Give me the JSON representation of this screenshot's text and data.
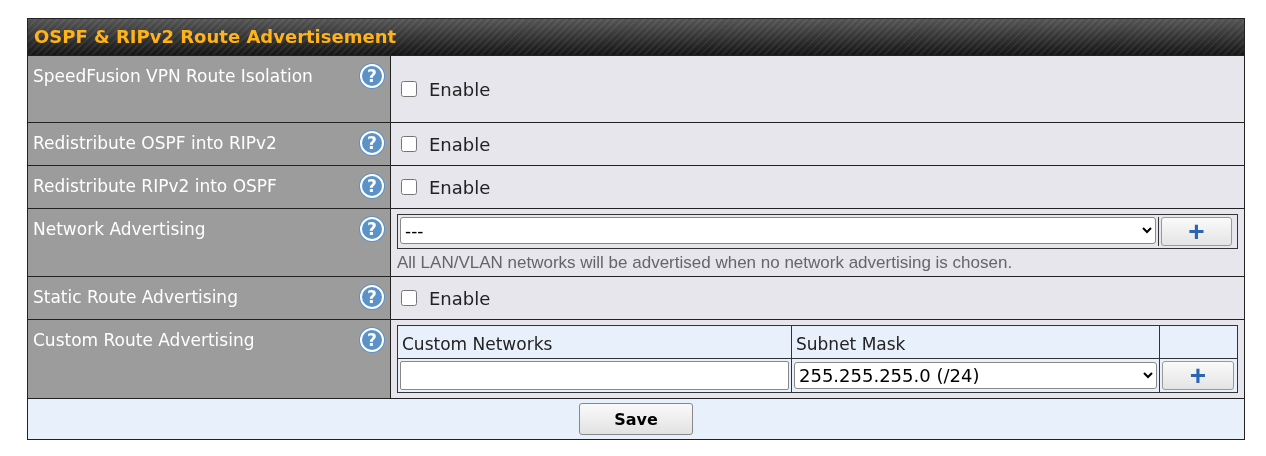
{
  "section": {
    "title": "OSPF & RIPv2 Route Advertisement"
  },
  "rows": [
    {
      "kind": "checkbox",
      "label": "SpeedFusion VPN Route Isolation",
      "help": "?",
      "option": "Enable",
      "checked": false
    },
    {
      "kind": "checkbox",
      "label": "Redistribute OSPF into RIPv2",
      "help": "?",
      "option": "Enable",
      "checked": false
    },
    {
      "kind": "checkbox",
      "label": "Redistribute RIPv2 into OSPF",
      "help": "?",
      "option": "Enable",
      "checked": false
    },
    {
      "kind": "select",
      "label": "Network Advertising",
      "help": "?",
      "value": "---",
      "add": "+",
      "note": "All LAN/VLAN networks will be advertised when no network advertising is chosen."
    },
    {
      "kind": "checkbox",
      "label": "Static Route Advertising",
      "help": "?",
      "option": "Enable",
      "checked": false
    },
    {
      "kind": "custom",
      "label": "Custom Route Advertising",
      "help": "?",
      "columns": [
        "Custom Networks",
        "Subnet Mask"
      ],
      "mask": "255.255.255.0 (/24)",
      "add": "+"
    }
  ],
  "save": "Save"
}
